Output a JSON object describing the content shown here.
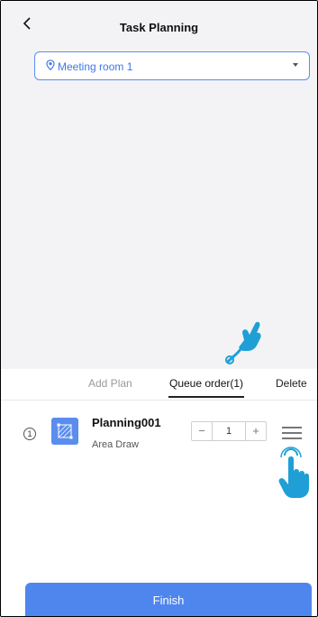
{
  "header": {
    "title": "Task Planning",
    "back_icon": "chevron-left-icon"
  },
  "location": {
    "selected": "Meeting room 1",
    "icon": "location-pin-icon",
    "caret_icon": "caret-down-icon"
  },
  "tabs": [
    {
      "label": "Add Plan",
      "active": false
    },
    {
      "label": "Queue order(1)",
      "active": true
    },
    {
      "label": "Delete",
      "active": false
    }
  ],
  "queue": [
    {
      "index": "1",
      "name": "Planning001",
      "type": "Area Draw",
      "count": "1",
      "thumbnail_icon": "area-draw-icon",
      "minus_label": "−",
      "plus_label": "+",
      "drag_icon": "drag-handle-icon"
    }
  ],
  "footer": {
    "finish_label": "Finish"
  },
  "overlays": {
    "tap_hand_icon": "pointing-hand-icon",
    "drag_hand_icon": "tap-hand-icon"
  },
  "colors": {
    "accent": "#4f86ee",
    "map_background": "#f3f3f6",
    "location_text": "#3f77ea"
  }
}
